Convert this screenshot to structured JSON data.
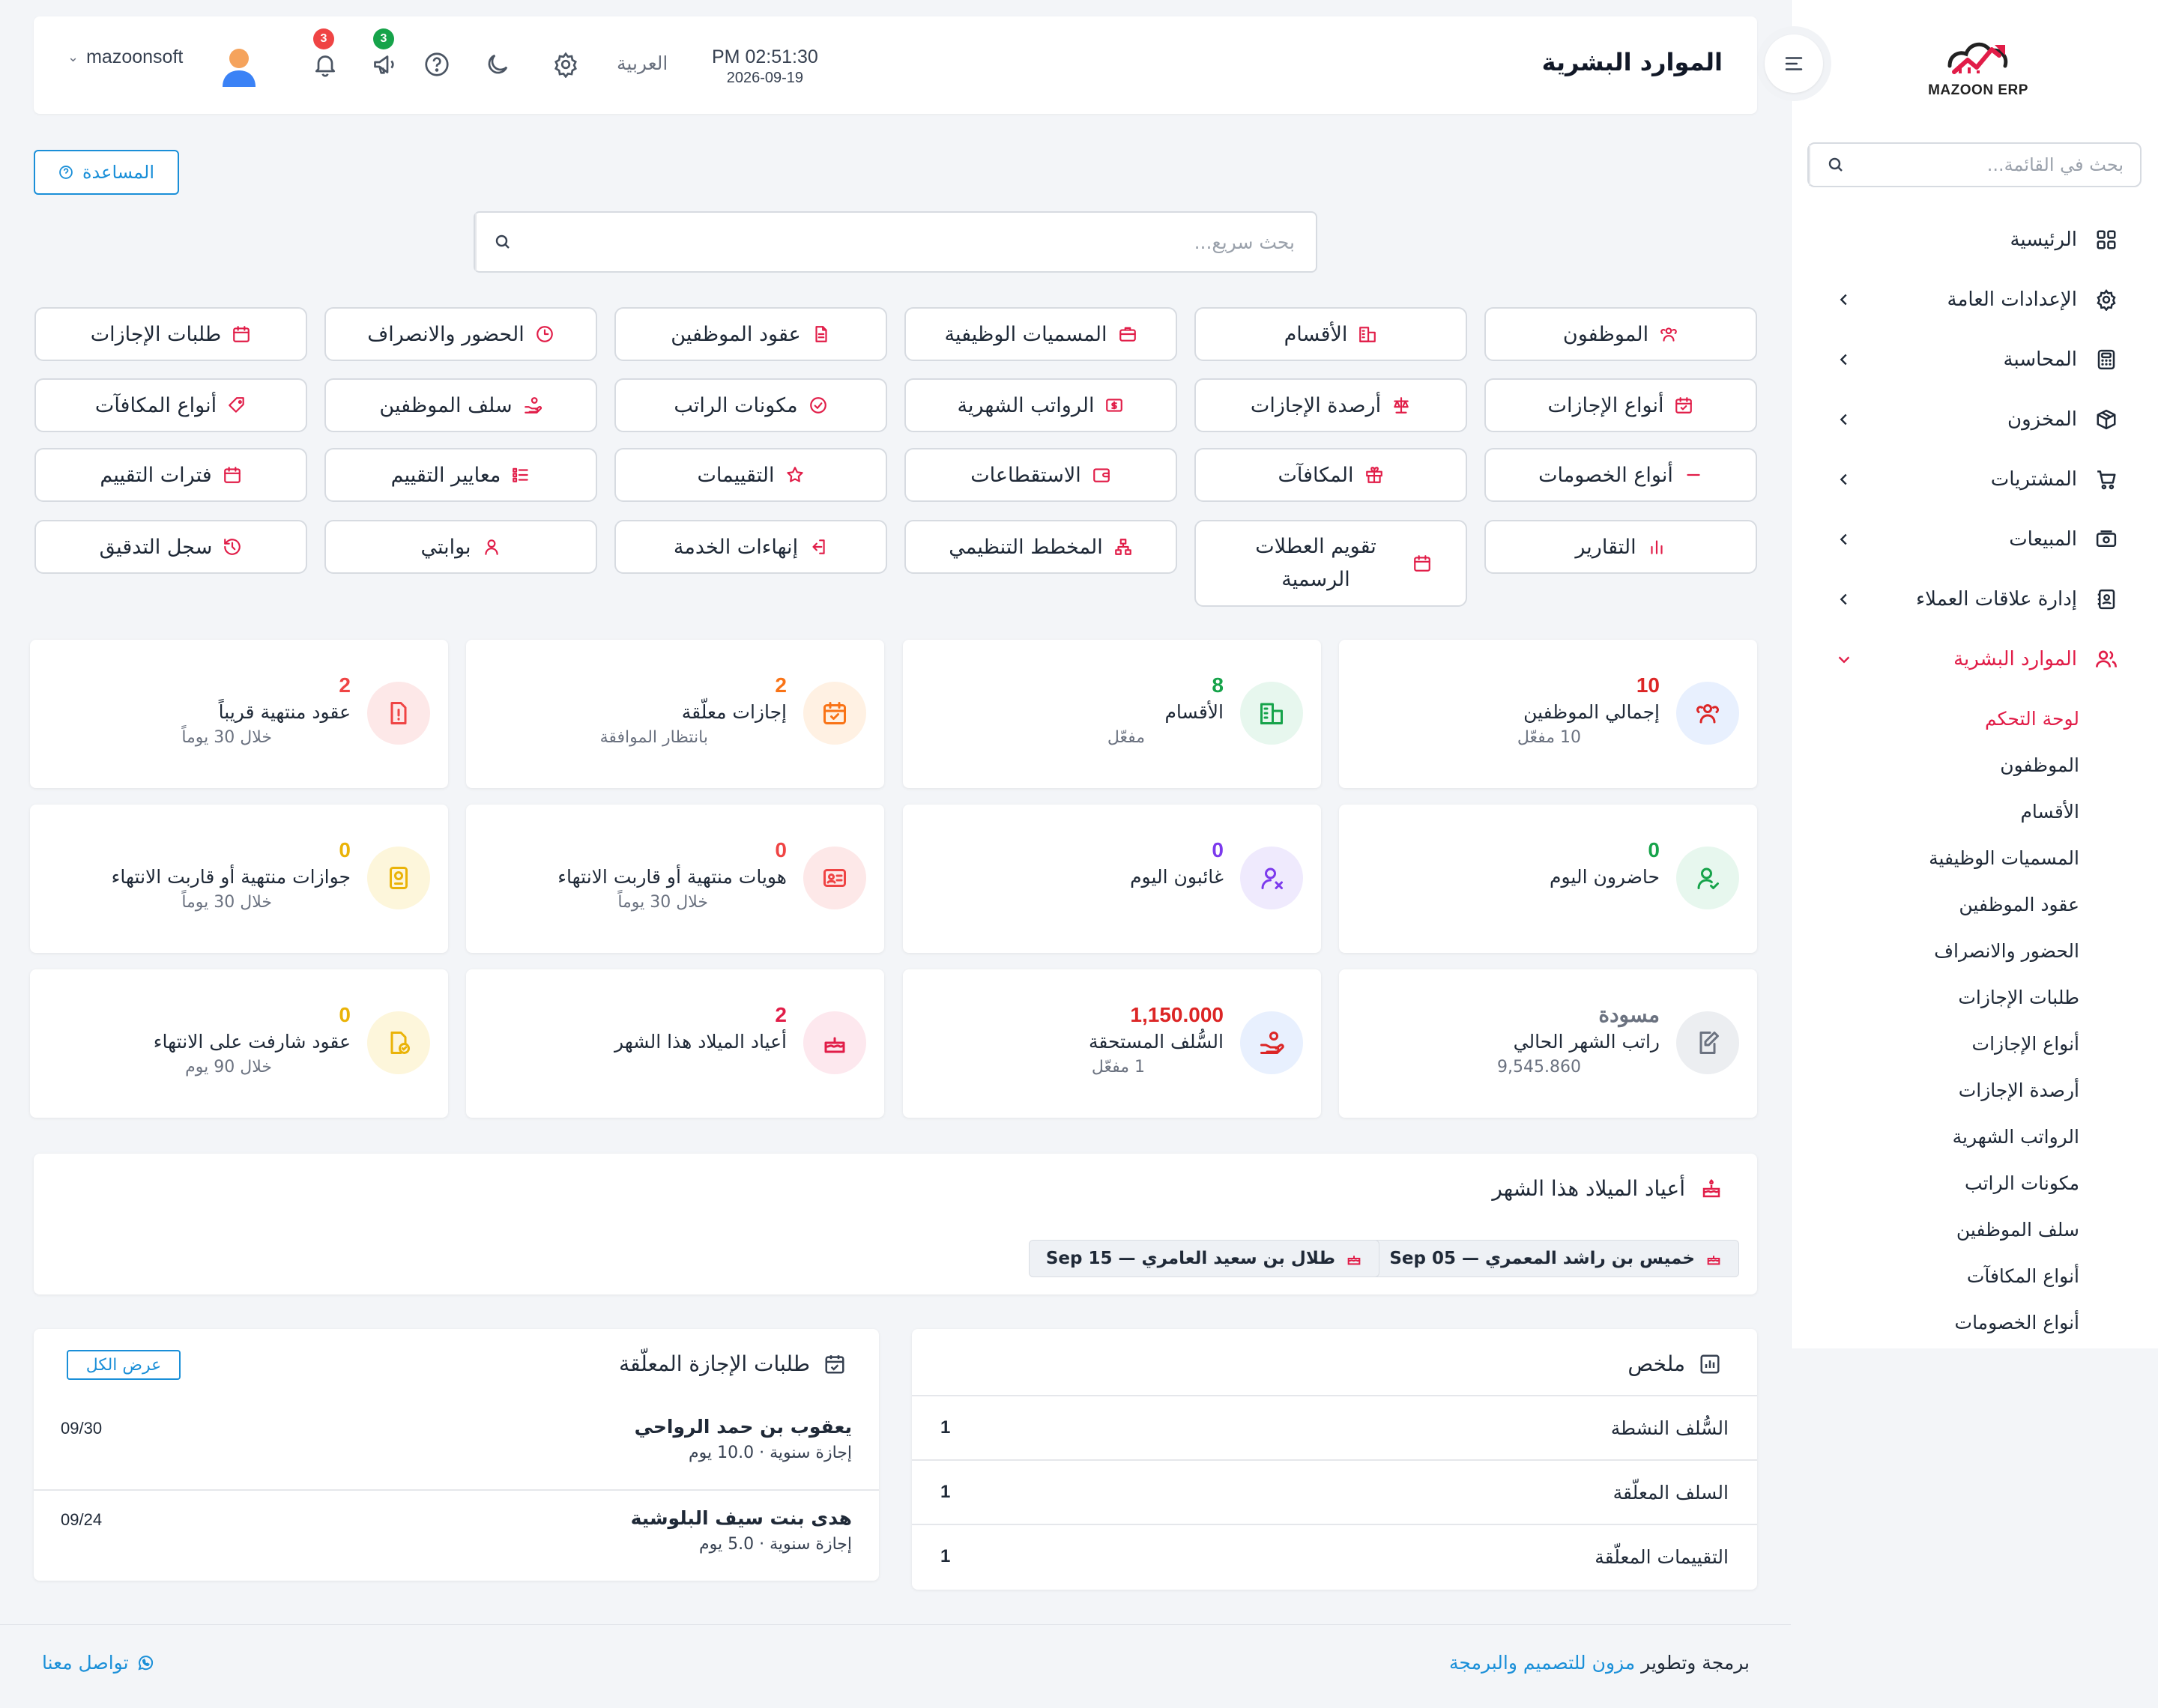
{
  "sidebar": {
    "logo_text": "MAZOON ERP",
    "logo_sub": "ERP",
    "search_placeholder": "بحث في القائمة...",
    "items": [
      {
        "label": "الرئيسية",
        "icon": "grid-icon",
        "has_children": false
      },
      {
        "label": "الإعدادات العامة",
        "icon": "gear-icon",
        "has_children": true
      },
      {
        "label": "المحاسبة",
        "icon": "calculator-icon",
        "has_children": true
      },
      {
        "label": "المخزون",
        "icon": "box-icon",
        "has_children": true
      },
      {
        "label": "المشتريات",
        "icon": "cart-icon",
        "has_children": true
      },
      {
        "label": "المبيعات",
        "icon": "cash-register-icon",
        "has_children": true
      },
      {
        "label": "إدارة علاقات العملاء",
        "icon": "contact-book-icon",
        "has_children": true
      },
      {
        "label": "الموارد البشرية",
        "icon": "users-icon",
        "has_children": true,
        "expanded": true
      }
    ],
    "hr_sub": [
      "لوحة التحكم",
      "الموظفون",
      "الأقسام",
      "المسميات الوظيفية",
      "عقود الموظفين",
      "الحضور والانصراف",
      "طلبات الإجازات",
      "أنواع الإجازات",
      "أرصدة الإجازات",
      "الرواتب الشهرية",
      "مكونات الراتب",
      "سلف الموظفين",
      "أنواع المكافآت",
      "أنواع الخصومات"
    ]
  },
  "header": {
    "title": "الموارد البشرية",
    "time": "PM 02:51:30",
    "date": "2026-09-19",
    "language": "العربية",
    "notifications_count": "3",
    "announcements_count": "3",
    "username": "mazoonsoft"
  },
  "help_label": "المساعدة",
  "quick_search_placeholder": "بحث سريع...",
  "quick_links": [
    [
      "الموظفون",
      "الأقسام",
      "المسميات الوظيفية",
      "عقود الموظفين",
      "الحضور والانصراف",
      "طلبات الإجازات"
    ],
    [
      "أنواع الإجازات",
      "أرصدة الإجازات",
      "الرواتب الشهرية",
      "مكونات الراتب",
      "سلف الموظفين",
      "أنواع المكافآت"
    ],
    [
      "أنواع الخصومات",
      "المكافآت",
      "الاستقطاعات",
      "التقييمات",
      "معايير التقييم",
      "فترات التقييم"
    ],
    [
      "التقارير",
      "تقويم العطلات الرسمية",
      "المخطط التنظيمي",
      "إنهاءات الخدمة",
      "بوابتي",
      "سجل التدقيق"
    ]
  ],
  "stats": [
    [
      {
        "value": "10",
        "label": "إجمالي الموظفين",
        "sub": "10 مفعّل",
        "color": "#dc2626"
      },
      {
        "value": "8",
        "label": "الأقسام",
        "sub": "مفعّل",
        "color": "#16a34a"
      },
      {
        "value": "2",
        "label": "إجازات معلّقة",
        "sub": "بانتظار الموافقة",
        "color": "#f97316"
      },
      {
        "value": "2",
        "label": "عقود منتهية قريباً",
        "sub": "خلال 30 يوماً",
        "color": "#ef4444"
      }
    ],
    [
      {
        "value": "0",
        "label": "حاضرون اليوم",
        "sub": "",
        "color": "#16a34a"
      },
      {
        "value": "0",
        "label": "غائبون اليوم",
        "sub": "",
        "color": "#7c3aed"
      },
      {
        "value": "0",
        "label": "هويات منتهية أو قاربت الانتهاء",
        "sub": "خلال 30 يوماً",
        "color": "#ef4444"
      },
      {
        "value": "0",
        "label": "جوازات منتهية أو قاربت الانتهاء",
        "sub": "خلال 30 يوماً",
        "color": "#eab308"
      }
    ],
    [
      {
        "value": "مسودة",
        "label": "راتب الشهر الحالي",
        "sub": "9,545.860",
        "color": "#6b7280"
      },
      {
        "value": "1,150.000",
        "label": "السُّلف المستحقة",
        "sub": "1 مفعّل",
        "color": "#dc2626"
      },
      {
        "value": "2",
        "label": "أعياد الميلاد هذا الشهر",
        "sub": "",
        "color": "#e11d48"
      },
      {
        "value": "0",
        "label": "عقود شارفت على الانتهاء",
        "sub": "خلال 90 يوم",
        "color": "#eab308"
      }
    ]
  ],
  "birthdays": {
    "title": "أعياد الميلاد هذا الشهر",
    "items": [
      "خميس بن راشد المعمري — Sep 05",
      "طلال بن سعيد العامري — Sep 15"
    ]
  },
  "summary": {
    "title": "ملخص",
    "rows": [
      {
        "label": "السُّلف النشطة",
        "value": "1"
      },
      {
        "label": "السلف المعلّقة",
        "value": "1"
      },
      {
        "label": "التقييمات المعلّقة",
        "value": "1"
      }
    ]
  },
  "pending_leaves": {
    "title": "طلبات الإجازة المعلّقة",
    "view_all": "عرض الكل",
    "rows": [
      {
        "name": "يعقوب بن حمد الرواحي",
        "detail": "إجازة سنوية · 10.0 يوم",
        "date": "09/30"
      },
      {
        "name": "هدى بنت سيف البلوشية",
        "detail": "إجازة سنوية · 5.0 يوم",
        "date": "09/24"
      }
    ]
  },
  "footer": {
    "credit_prefix": "برمجة وتطوير",
    "credit_link": "مزون للتصميم والبرمجة",
    "contact": "تواصل معنا"
  },
  "colors": {
    "accent": "#e11d48",
    "link": "#1a8fd8",
    "text": "#1f2937",
    "background": "#f3f5f8"
  }
}
